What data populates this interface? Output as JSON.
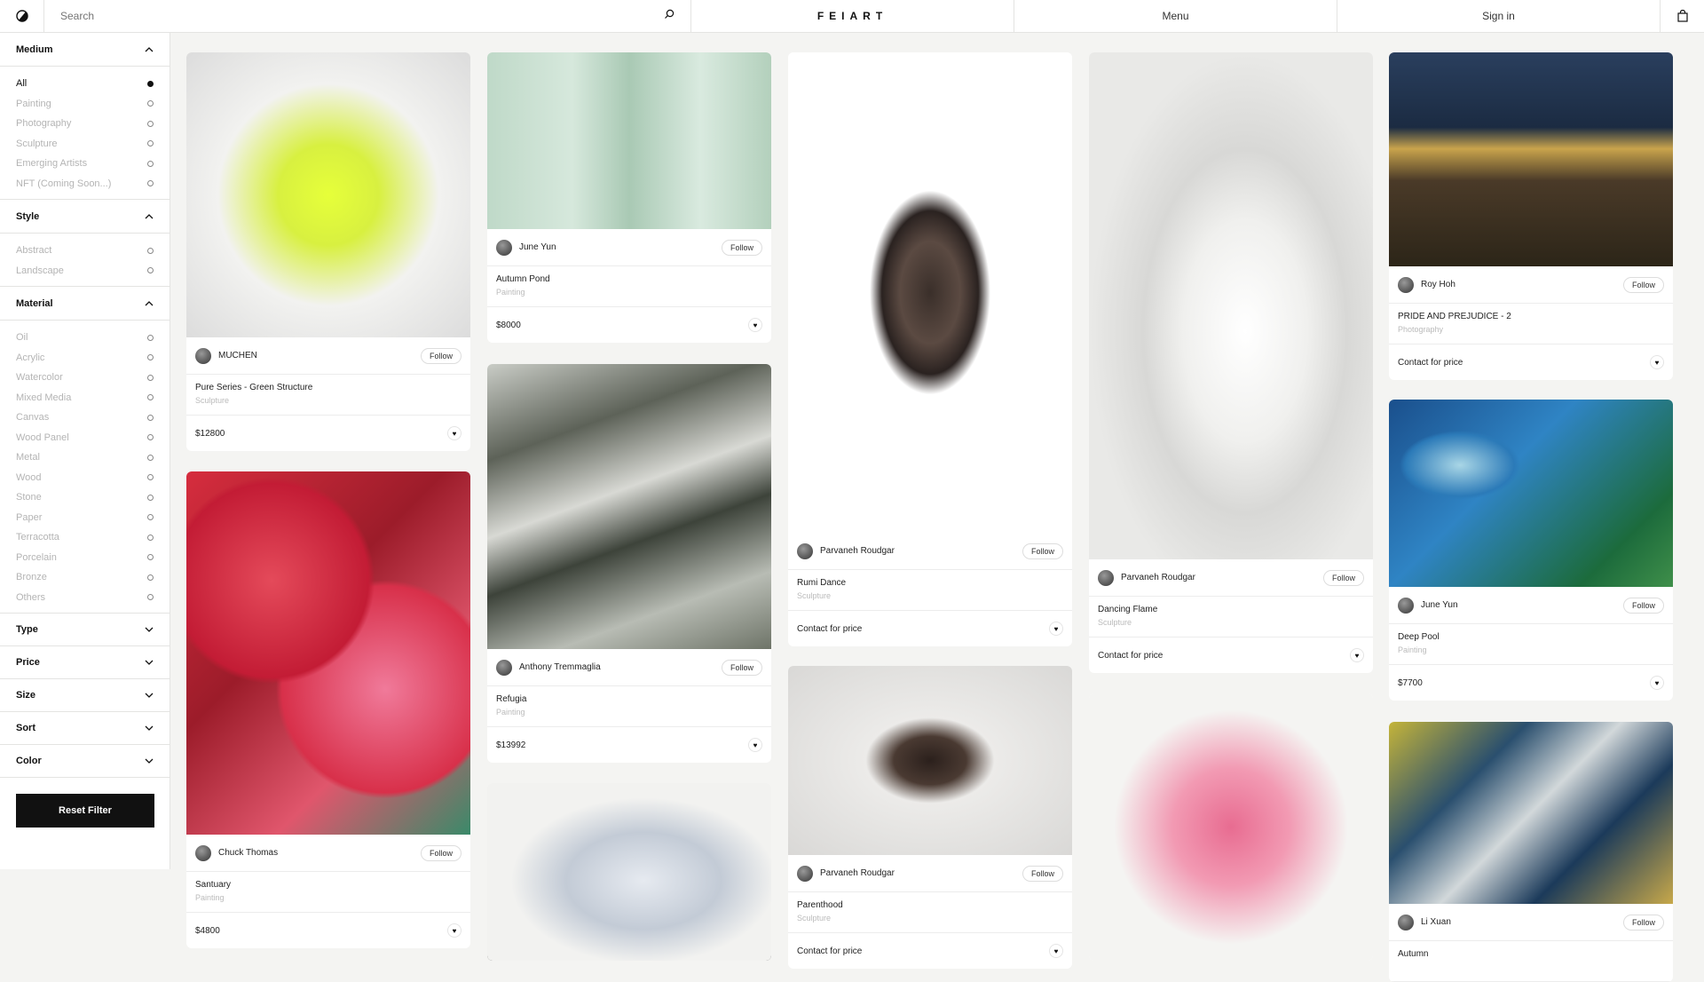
{
  "topbar": {
    "search_placeholder": "Search",
    "brand": "FEIART",
    "menu": "Menu",
    "signin": "Sign in"
  },
  "sidebar": {
    "medium": {
      "title": "Medium",
      "options": [
        "All",
        "Painting",
        "Photography",
        "Sculpture",
        "Emerging Artists",
        "NFT (Coming Soon...)"
      ]
    },
    "style": {
      "title": "Style",
      "options": [
        "Abstract",
        "Landscape"
      ]
    },
    "material": {
      "title": "Material",
      "options": [
        "Oil",
        "Acrylic",
        "Watercolor",
        "Mixed Media",
        "Canvas",
        "Wood Panel",
        "Metal",
        "Wood",
        "Stone",
        "Paper",
        "Terracotta",
        "Porcelain",
        "Bronze",
        "Others"
      ]
    },
    "collapsed": [
      "Type",
      "Price",
      "Size",
      "Sort",
      "Color"
    ],
    "reset": "Reset Filter"
  },
  "follow_label": "Follow",
  "cards": [
    {
      "artist": "MUCHEN",
      "title": "Pure Series - Green Structure",
      "category": "Sculpture",
      "price": "$12800"
    },
    {
      "artist": "Chuck Thomas",
      "title": "Santuary",
      "category": "Painting",
      "price": "$4800"
    },
    {
      "artist": "June Yun",
      "title": "Autumn Pond",
      "category": "Painting",
      "price": "$8000"
    },
    {
      "artist": "Anthony Tremmaglia",
      "title": "Refugia",
      "category": "Painting",
      "price": "$13992"
    },
    {
      "artist": "Parvaneh Roudgar",
      "title": "Rumi Dance",
      "category": "Sculpture",
      "price": "Contact for price"
    },
    {
      "artist": "Parvaneh Roudgar",
      "title": "Parenthood",
      "category": "Sculpture",
      "price": "Contact for price"
    },
    {
      "artist": "Parvaneh Roudgar",
      "title": "Dancing Flame",
      "category": "Sculpture",
      "price": "Contact for price"
    },
    {
      "artist": "Roy Hoh",
      "title": "PRIDE AND PREJUDICE - 2",
      "category": "Photography",
      "price": "Contact for price"
    },
    {
      "artist": "June Yun",
      "title": "Deep Pool",
      "category": "Painting",
      "price": "$7700"
    },
    {
      "artist": "Li Xuan",
      "title": "Autumn",
      "category": "",
      "price": ""
    }
  ]
}
